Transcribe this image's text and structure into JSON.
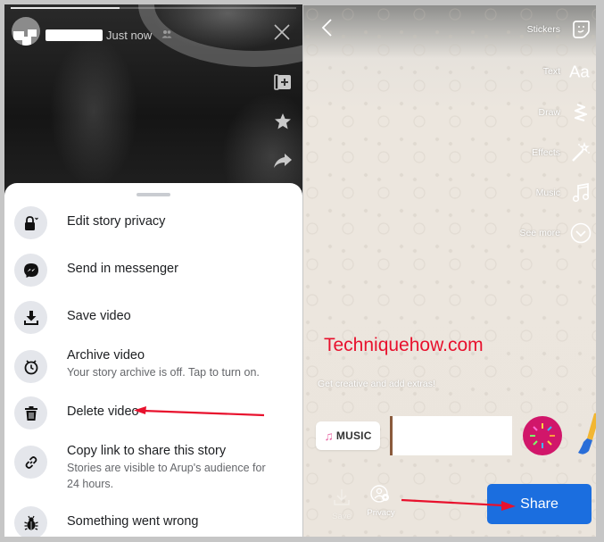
{
  "story_viewer": {
    "timestamp": "Just now",
    "audience_icon": "friends-icon",
    "progress": 0.38,
    "close_icon": "close-icon",
    "side_actions": [
      {
        "icon": "add-to-story-icon"
      },
      {
        "icon": "star-icon"
      },
      {
        "icon": "share-arrow-icon"
      }
    ]
  },
  "menu": {
    "items": [
      {
        "label": "Edit story privacy",
        "icon": "lock-icon"
      },
      {
        "label": "Send in messenger",
        "icon": "messenger-icon"
      },
      {
        "label": "Save video",
        "icon": "download-icon"
      },
      {
        "label": "Archive video",
        "sub": "Your story archive is off. Tap to turn on.",
        "icon": "archive-clock-icon"
      },
      {
        "label": "Delete video",
        "icon": "trash-icon"
      },
      {
        "label": "Copy link to share this story",
        "sub": "Stories are visible to Arup's audience for 24 hours.",
        "icon": "link-icon"
      },
      {
        "label": "Something went wrong",
        "icon": "bug-icon"
      }
    ]
  },
  "editor": {
    "tools": [
      {
        "label": "Stickers",
        "icon": "sticker-icon"
      },
      {
        "label": "Text",
        "icon": "text-aa-icon"
      },
      {
        "label": "Draw",
        "icon": "draw-squiggle-icon"
      },
      {
        "label": "Effects",
        "icon": "magic-wand-icon"
      },
      {
        "label": "Music",
        "icon": "music-note-icon"
      },
      {
        "label": "See more",
        "icon": "chevron-down-circle-icon"
      }
    ],
    "watermark": "Techniquehow.com",
    "hint": "Get creative and add extras!",
    "music_sticker": "MUSIC",
    "save_label": "Save",
    "privacy_label": "Privacy",
    "share_label": "Share"
  },
  "colors": {
    "share_blue": "#1b6edf",
    "arrow_red": "#e8112d",
    "watermark_red": "#e8112d"
  }
}
